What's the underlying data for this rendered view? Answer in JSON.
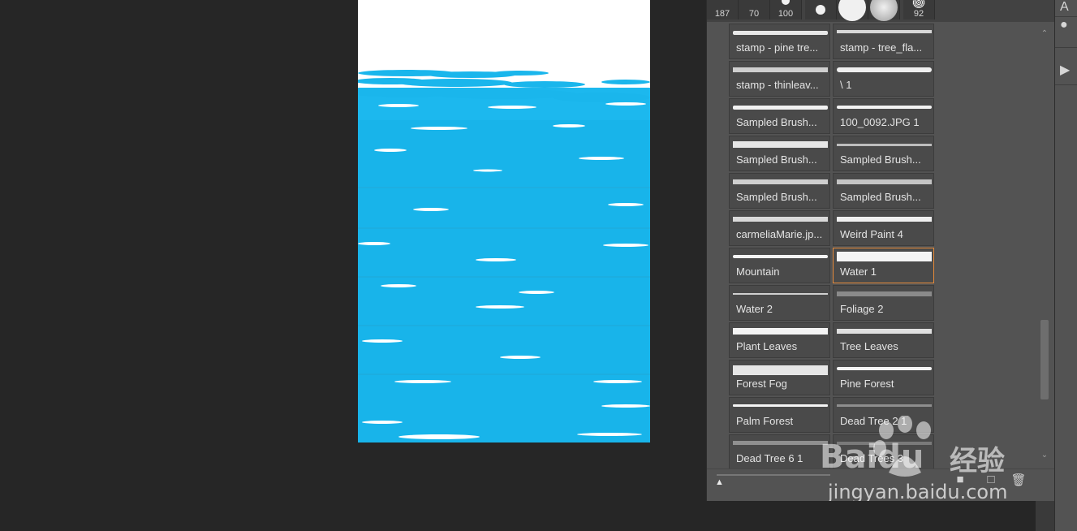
{
  "preset_strip": {
    "tiles": [
      {
        "label": "187"
      },
      {
        "label": "70"
      },
      {
        "label": "100"
      },
      {
        "label": ""
      },
      {
        "label": ""
      },
      {
        "label": ""
      },
      {
        "label": "92"
      }
    ]
  },
  "brush_list": {
    "items": [
      {
        "label": "stamp - pine tre..."
      },
      {
        "label": "stamp - tree_fla..."
      },
      {
        "label": "stamp - thinleav..."
      },
      {
        "label": "\\ 1"
      },
      {
        "label": "Sampled Brush..."
      },
      {
        "label": "100_0092.JPG 1"
      },
      {
        "label": "Sampled Brush..."
      },
      {
        "label": "Sampled Brush..."
      },
      {
        "label": "Sampled Brush..."
      },
      {
        "label": "Sampled Brush..."
      },
      {
        "label": "carmeliaMarie.jp..."
      },
      {
        "label": "Weird Paint 4"
      },
      {
        "label": "Mountain"
      },
      {
        "label": "Water 1"
      },
      {
        "label": "Water 2"
      },
      {
        "label": "Foliage 2"
      },
      {
        "label": "Plant Leaves"
      },
      {
        "label": "Tree Leaves"
      },
      {
        "label": "Forest Fog"
      },
      {
        "label": "Pine Forest"
      },
      {
        "label": "Palm Forest"
      },
      {
        "label": "Dead Tree 2 1"
      },
      {
        "label": "Dead Tree 6 1"
      },
      {
        "label": "Dead Trees 3"
      }
    ],
    "selected": "Water 1"
  },
  "watermark": {
    "brand": "Baidu",
    "tagline": "经验",
    "url": "jingyan.baidu.com"
  },
  "colors": {
    "water": "#18b4ea",
    "selected_border": "#e58a3a"
  }
}
